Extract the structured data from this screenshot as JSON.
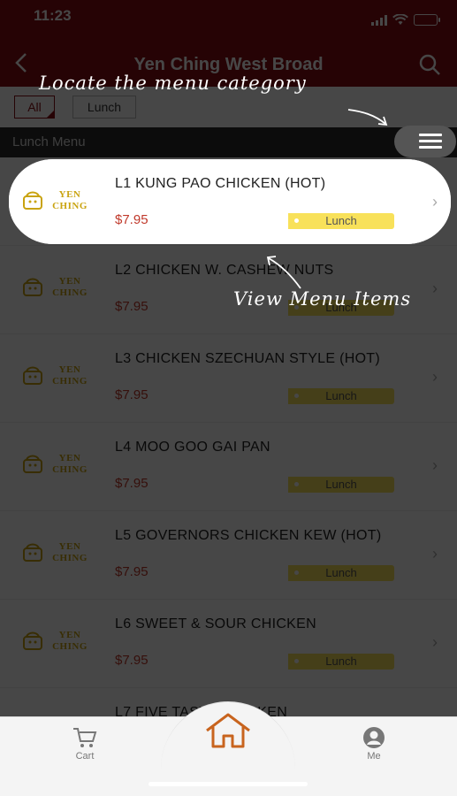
{
  "status_bar": {
    "time": "11:23"
  },
  "header": {
    "title": "Yen Ching West Broad",
    "back_icon": "chevron-left-icon",
    "search_icon": "search-icon"
  },
  "filters": {
    "all": "All",
    "lunch": "Lunch"
  },
  "category": {
    "label": "Lunch Menu",
    "toggle_icon": "hamburger-menu-icon"
  },
  "logo": {
    "line1": "YEN",
    "line2": "CHING"
  },
  "items": [
    {
      "name": "L1 KUNG PAO CHICKEN (HOT)",
      "price": "$7.95",
      "tag": "Lunch"
    },
    {
      "name": "L2 CHICKEN W. CASHEW NUTS",
      "price": "$7.95",
      "tag": "Lunch"
    },
    {
      "name": "L3 CHICKEN SZECHUAN STYLE (HOT)",
      "price": "$7.95",
      "tag": "Lunch"
    },
    {
      "name": "L4 MOO GOO GAI PAN",
      "price": "$7.95",
      "tag": "Lunch"
    },
    {
      "name": "L5 GOVERNORS CHICKEN KEW (HOT)",
      "price": "$7.95",
      "tag": "Lunch"
    },
    {
      "name": "L6 SWEET & SOUR CHICKEN",
      "price": "$7.95",
      "tag": "Lunch"
    },
    {
      "name": "L7 FIVE TASTE CHICKEN",
      "price": "",
      "tag": ""
    }
  ],
  "annotations": {
    "category_hint": "Locate the menu category",
    "items_hint": "View Menu Items"
  },
  "tabs": {
    "cart": "Cart",
    "me": "Me",
    "home_icon": "home-icon"
  },
  "colors": {
    "brand": "#8a0d12",
    "price": "#c0392b",
    "tag": "#f8e15a",
    "logo": "#c9a30f"
  }
}
